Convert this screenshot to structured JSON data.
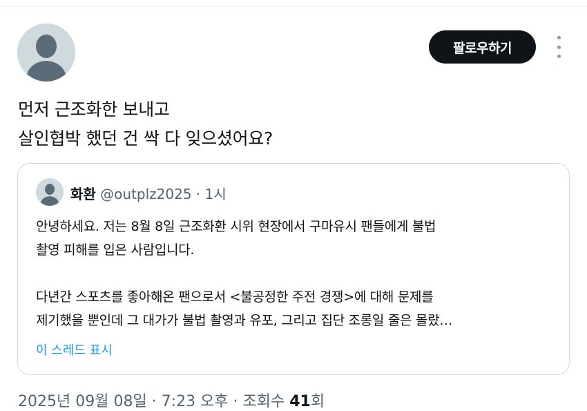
{
  "post": {
    "follow_label": "팔로우하기",
    "text_lines": [
      "먼저 근조화한 보내고",
      "살인협박 했던 건 싹 다 잊으셨어요?"
    ],
    "quote": {
      "name": "화환",
      "handle": "@outplz2025",
      "separator": " · ",
      "time": "1시",
      "body_lines": [
        "안녕하세요. 저는 8월 8일 근조화환 시위 현장에서 구마유시 팬들에게 불법",
        "촬영 피해를 입은 사람입니다.",
        "",
        "다년간 스포츠를 좋아해온 팬으로서 <불공정한 주전 경쟁>에 대해 문제를",
        "제기했을 뿐인데 그 대가가 불법 촬영과 유포, 그리고 집단 조롱일 줄은 몰랐…"
      ],
      "show_thread_label": "이 스레드 표시"
    },
    "meta": {
      "date_time": "2025년 09월 08일 · 7:23 오후 · 조회수 ",
      "views": "41",
      "views_suffix": "회"
    }
  },
  "icons": {
    "more": "more-vertical-icon",
    "avatar": "default-avatar-icon"
  },
  "colors": {
    "follow_bg": "#0f1419",
    "link": "#1d9bf0",
    "secondary": "#536471",
    "border": "#cfd9de"
  }
}
